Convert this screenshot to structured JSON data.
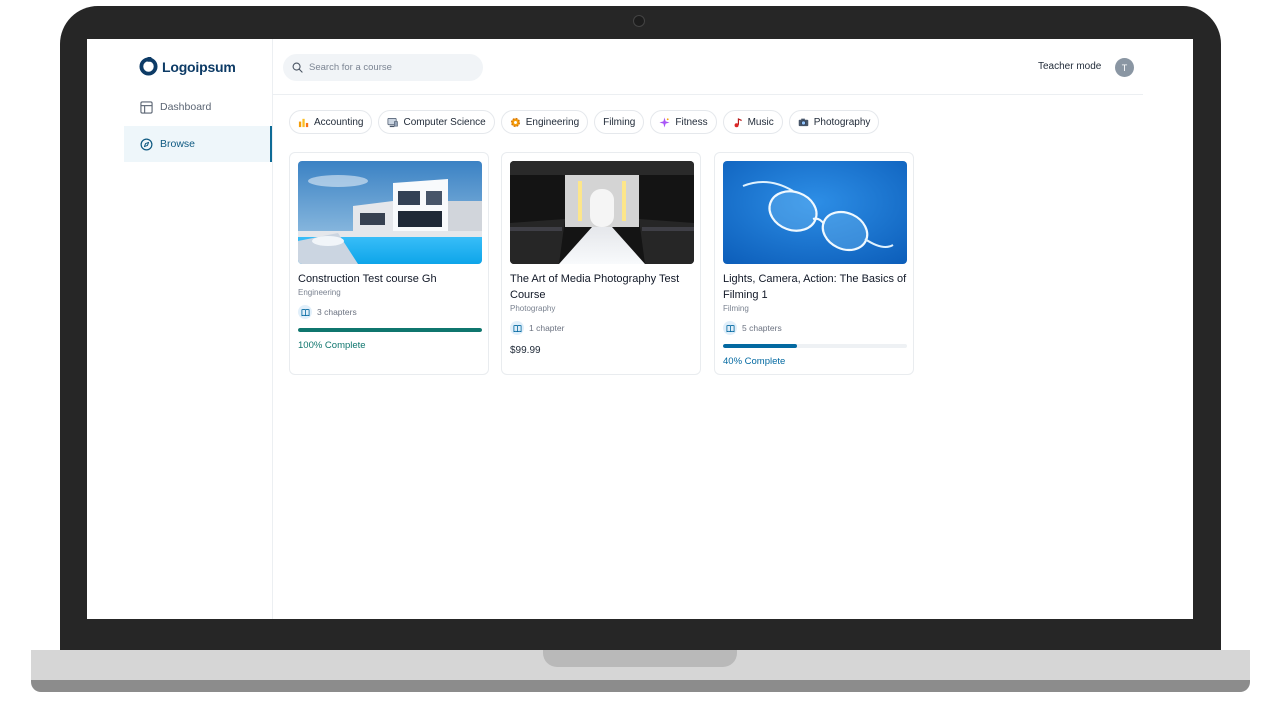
{
  "brand": {
    "name": "Logoipsum"
  },
  "sidebar": {
    "items": [
      {
        "label": "Dashboard",
        "icon": "layout-icon",
        "active": false
      },
      {
        "label": "Browse",
        "icon": "compass-icon",
        "active": true
      }
    ]
  },
  "header": {
    "search_placeholder": "Search for a course",
    "teacher_mode_label": "Teacher mode",
    "avatar_initial": "T"
  },
  "categories": [
    {
      "label": "Accounting",
      "icon": "bar-chart-icon"
    },
    {
      "label": "Computer Science",
      "icon": "computer-icon"
    },
    {
      "label": "Engineering",
      "icon": "gear-icon"
    },
    {
      "label": "Filming",
      "icon": ""
    },
    {
      "label": "Fitness",
      "icon": "sparkle-icon"
    },
    {
      "label": "Music",
      "icon": "music-note-icon"
    },
    {
      "label": "Photography",
      "icon": "camera-icon"
    }
  ],
  "courses": [
    {
      "title": "Construction Test course Gh",
      "category": "Engineering",
      "chapters": "3 chapters",
      "progress": 100,
      "progress_label": "100% Complete",
      "progress_color": "#0f766e",
      "thumbnail": "modern-house-pool-image"
    },
    {
      "title": "The Art of Media Photography Test Course",
      "category": "Photography",
      "chapters": "1 chapter",
      "price": "$99.99",
      "thumbnail": "runway-hall-image"
    },
    {
      "title": "Lights, Camera, Action: The Basics of Filming 1",
      "category": "Filming",
      "chapters": "5 chapters",
      "progress": 40,
      "progress_label": "40% Complete",
      "progress_color": "#0369a1",
      "thumbnail": "eyeglasses-blue-image"
    }
  ],
  "colors": {
    "brand": "#0d3b66",
    "accent": "#0e6b96",
    "complete": "#0f766e",
    "in_progress": "#0369a1"
  }
}
